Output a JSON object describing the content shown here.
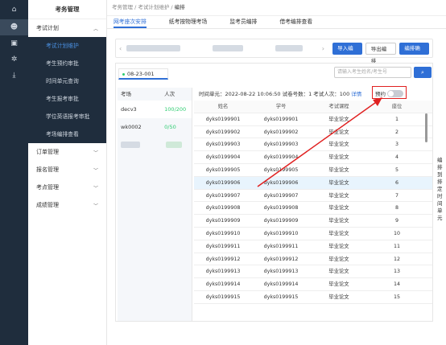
{
  "rail": {
    "icons": [
      "home-icon",
      "user-icon",
      "panel-icon",
      "gear-icon",
      "download-icon"
    ]
  },
  "sidebar": {
    "title": "考务管理",
    "group_open": "考试计划",
    "items": [
      "考试计划维护",
      "考生预约审批",
      "时间单元查询",
      "考生报考审批",
      "学位英语报考审批",
      "考场编排查看"
    ],
    "groups": [
      "订单管理",
      "报名管理",
      "考点管理",
      "成绩管理"
    ]
  },
  "breadcrumb": {
    "a": "考务管理",
    "b": "考试计划维护",
    "c": "编排"
  },
  "tabs": [
    "网考座次安排",
    "纸考按物理考场",
    "监考员编排",
    "借考编排查看"
  ],
  "toolbar": {
    "import": "导入编排",
    "export": "导出编排",
    "confirm": "编排确认"
  },
  "panel": {
    "room_tab": "08-23-001",
    "search_placeholder": "请输入考生姓名/考生号",
    "info": "时间单元：2022-08-22 10:06:50  试卷号数：1  考试人次：100",
    "detail": "详情",
    "toggle_label": "预约",
    "toggle_text": "关闭"
  },
  "left_list": {
    "head": [
      "考场",
      "人次"
    ],
    "rows": [
      [
        "decv3",
        "100/200"
      ],
      [
        "wk0002",
        "0/50"
      ]
    ]
  },
  "grid": {
    "headers": [
      "姓名",
      "学号",
      "考试课程",
      "座位"
    ],
    "rows": [
      [
        "dyks0199901",
        "dyks0199901",
        "毕业论文",
        "1"
      ],
      [
        "dyks0199902",
        "dyks0199902",
        "毕业论文",
        "2"
      ],
      [
        "dyks0199903",
        "dyks0199903",
        "毕业论文",
        "3"
      ],
      [
        "dyks0199904",
        "dyks0199904",
        "毕业论文",
        "4"
      ],
      [
        "dyks0199905",
        "dyks0199905",
        "毕业论文",
        "5"
      ],
      [
        "dyks0199906",
        "dyks0199906",
        "毕业论文",
        "6"
      ],
      [
        "dyks0199907",
        "dyks0199907",
        "毕业论文",
        "7"
      ],
      [
        "dyks0199908",
        "dyks0199908",
        "毕业论文",
        "8"
      ],
      [
        "dyks0199909",
        "dyks0199909",
        "毕业论文",
        "9"
      ],
      [
        "dyks0199910",
        "dyks0199910",
        "毕业论文",
        "10"
      ],
      [
        "dyks0199911",
        "dyks0199911",
        "毕业论文",
        "11"
      ],
      [
        "dyks0199912",
        "dyks0199912",
        "毕业论文",
        "12"
      ],
      [
        "dyks0199913",
        "dyks0199913",
        "毕业论文",
        "13"
      ],
      [
        "dyks0199914",
        "dyks0199914",
        "毕业论文",
        "14"
      ],
      [
        "dyks0199915",
        "dyks0199915",
        "毕业论文",
        "15"
      ]
    ],
    "highlight_row": 5
  },
  "right_note": "编排到排定时间单元",
  "colors": {
    "accent": "#2f6fd6",
    "annotation": "#e02020",
    "ok": "#2ecc71"
  }
}
